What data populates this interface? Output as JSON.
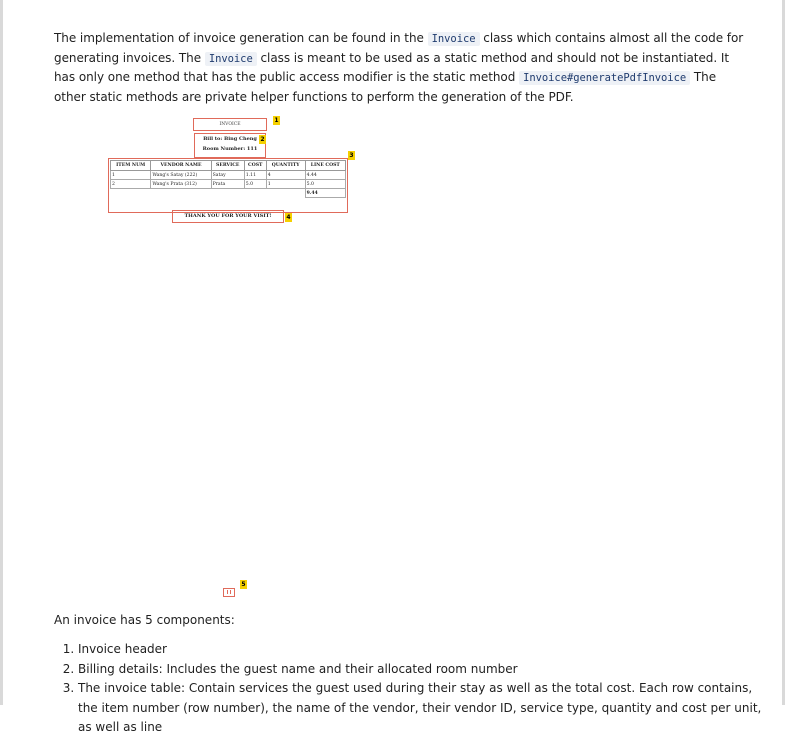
{
  "intro": {
    "t1": "The implementation of invoice generation can be found in the ",
    "c1": "Invoice",
    "t2": " class which contains almost all the code for generating invoices. The ",
    "c2": "Invoice",
    "t3": " class is meant to be used as a static method and should not be instantiated. It has only one method that has the public access modifier is the static method ",
    "c3": "Invoice#generatePdfInvoice",
    "t4": " The other static methods are private helper functions to perform the generation of the PDF."
  },
  "figure": {
    "header": "INVOICE",
    "bill_to": "Bill to: Bing Cheng",
    "room": "Room Number: 111",
    "columns": [
      "ITEM NUM",
      "VENDOR NAME",
      "SERVICE",
      "COST",
      "QUANTITY",
      "LINE COST"
    ],
    "rows": [
      [
        "1",
        "Wang's Satay (222)",
        "Satay",
        "1.11",
        "4",
        "4.44"
      ],
      [
        "2",
        "Wang's Prata (312)",
        "Prata",
        "5.0",
        "1",
        "5.0"
      ]
    ],
    "total": "9.44",
    "thanks": "THANK YOU FOR YOUR VISIT!",
    "badges": [
      "1",
      "2",
      "3",
      "4",
      "5"
    ]
  },
  "components_intro": "An invoice has 5 components:",
  "components": [
    "Invoice header",
    "Billing details: Includes the guest name and their allocated room number",
    "The invoice table: Contain services the guest used during their stay as well as the total cost. Each row contains, the item number (row number), the name of the vendor, their vendor ID, service type, quantity and cost per unit, as well as line"
  ]
}
